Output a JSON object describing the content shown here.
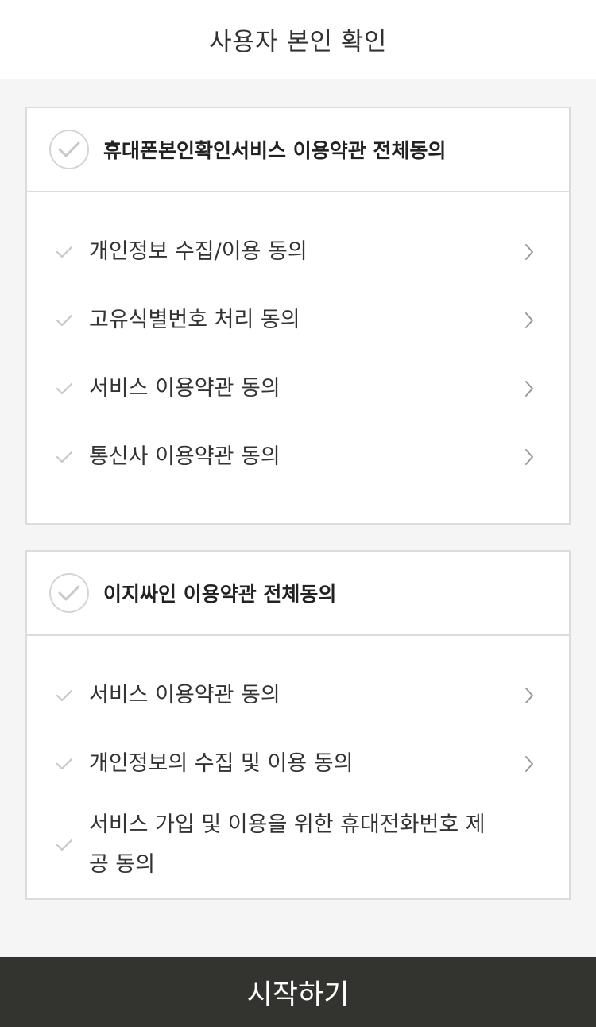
{
  "header": {
    "title": "사용자 본인 확인"
  },
  "sections": [
    {
      "title": "휴대폰본인확인서비스 이용약관 전체동의",
      "items": [
        {
          "label": "개인정보 수집/이용 동의",
          "has_chevron": true
        },
        {
          "label": "고유식별번호 처리 동의",
          "has_chevron": true
        },
        {
          "label": "서비스 이용약관 동의",
          "has_chevron": true
        },
        {
          "label": "통신사 이용약관 동의",
          "has_chevron": true
        }
      ]
    },
    {
      "title": "이지싸인 이용약관 전체동의",
      "items": [
        {
          "label": "서비스 이용약관 동의",
          "has_chevron": true
        },
        {
          "label": "개인정보의 수집 및 이용 동의",
          "has_chevron": true
        },
        {
          "label": "서비스 가입 및 이용을 위한 휴대전화번호 제공 동의",
          "has_chevron": false
        }
      ]
    }
  ],
  "footer": {
    "start_label": "시작하기"
  },
  "icons": {
    "circle_check": "check-circle-icon",
    "item_check": "check-icon",
    "chevron": "chevron-right-icon"
  },
  "colors": {
    "border": "#dcdcdc",
    "check": "#c8c8c8",
    "button_bg": "#333330",
    "background": "#f5f5f5"
  }
}
